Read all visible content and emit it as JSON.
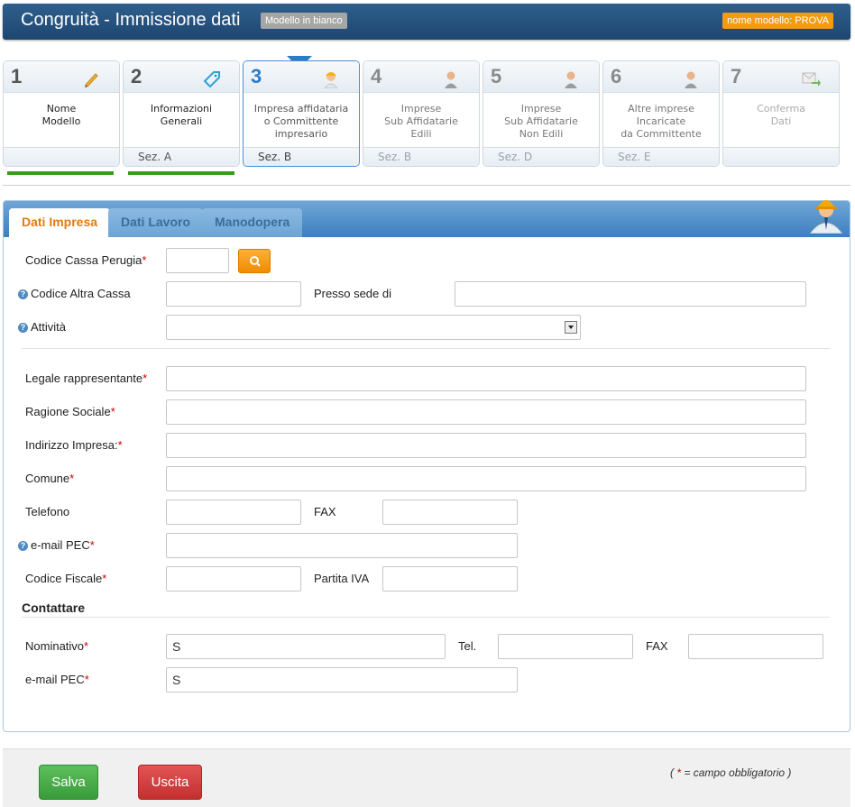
{
  "header": {
    "title": "Congruità - Immissione dati",
    "badge_model": "Modello in bianco",
    "badge_name": "nome modello: PROVA"
  },
  "steps": [
    {
      "num": "1",
      "label": "Nome\nModello",
      "section": "",
      "icon": "pencil-icon"
    },
    {
      "num": "2",
      "label": "Informazioni\nGenerali",
      "section": "Sez. A",
      "icon": "tag-icon"
    },
    {
      "num": "3",
      "label": "Impresa affidataria\no Committente\nimpresario",
      "section": "Sez. B",
      "icon": "worker-icon"
    },
    {
      "num": "4",
      "label": "Imprese\nSub Affidatarie\nEdili",
      "section": "Sez. B",
      "icon": "person-icon"
    },
    {
      "num": "5",
      "label": "Imprese\nSub Affidatarie\nNon Edili",
      "section": "Sez. D",
      "icon": "person-icon"
    },
    {
      "num": "6",
      "label": "Altre imprese\nIncaricate\nda Committente",
      "section": "Sez. E",
      "icon": "person-icon"
    },
    {
      "num": "7",
      "label": "Conferma\nDati",
      "section": "",
      "icon": "send-icon"
    }
  ],
  "tabs": [
    "Dati Impresa",
    "Dati Lavoro",
    "Manodopera"
  ],
  "form": {
    "codice_cassa_perugia": {
      "label": "Codice Cassa Perugia",
      "value": ""
    },
    "codice_altra_cassa": {
      "label": "Codice Altra Cassa",
      "value": ""
    },
    "presso_sede_di": {
      "label": "Presso sede di",
      "value": ""
    },
    "attivita": {
      "label": "Attività",
      "value": ""
    },
    "legale_rappresentante": {
      "label": "Legale rappresentante",
      "value": ""
    },
    "ragione_sociale": {
      "label": "Ragione Sociale",
      "value": ""
    },
    "indirizzo_impresa": {
      "label": "Indirizzo Impresa:",
      "value": ""
    },
    "comune": {
      "label": "Comune",
      "value": ""
    },
    "telefono": {
      "label": "Telefono",
      "value": ""
    },
    "fax": {
      "label": "FAX",
      "value": ""
    },
    "email_pec": {
      "label": "e-mail PEC",
      "value": ""
    },
    "codice_fiscale": {
      "label": "Codice Fiscale",
      "value": ""
    },
    "partita_iva": {
      "label": "Partita IVA",
      "value": ""
    }
  },
  "contact": {
    "title": "Contattare",
    "nominativo": {
      "label": "Nominativo",
      "value": "S"
    },
    "tel": {
      "label": "Tel.",
      "value": ""
    },
    "fax": {
      "label": "FAX",
      "value": ""
    },
    "email_pec": {
      "label": "e-mail PEC",
      "value": "S"
    }
  },
  "required_mark": "*",
  "footer": {
    "save_label": "Salva",
    "exit_label": "Uscita",
    "legend_open": "( ",
    "legend_text": " = campo obbligatorio )"
  },
  "colors": {
    "header": "#1d4670",
    "accent_orange": "#f39c12",
    "progress_green": "#3a9b1a",
    "save_green": "#3a9b3a",
    "exit_red": "#c32f2f"
  }
}
